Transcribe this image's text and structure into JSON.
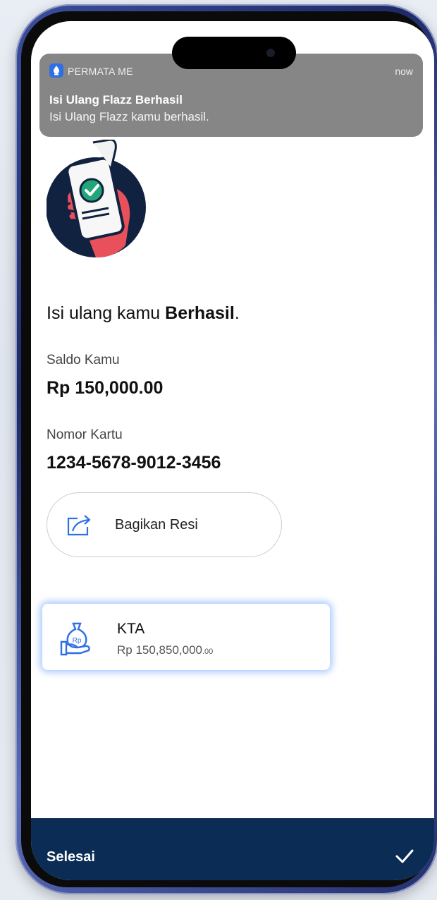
{
  "notification": {
    "app_name": "PERMATA ME",
    "time": "now",
    "title": "Isi Ulang Flazz Berhasil",
    "body": "Isi Ulang Flazz kamu berhasil."
  },
  "result": {
    "headline_prefix": "Isi ulang kamu ",
    "headline_bold": "Berhasil",
    "headline_suffix": "."
  },
  "balance": {
    "label": "Saldo Kamu",
    "value": "Rp 150,000.00"
  },
  "card": {
    "label": "Nomor Kartu",
    "number": "1234-5678-9012-3456"
  },
  "share": {
    "label": "Bagikan Resi",
    "icon": "share-icon"
  },
  "kta": {
    "title": "KTA",
    "amount_main": "Rp 150,850,000",
    "amount_decimals": ".00",
    "icon": "money-bag-hand-icon"
  },
  "footer": {
    "done_label": "Selesai",
    "icon": "check-icon"
  },
  "colors": {
    "footer_bg": "#0a2c55",
    "accent_blue": "#2f6fe4",
    "illustration_circle": "#10223f",
    "hand": "#e8505b"
  }
}
